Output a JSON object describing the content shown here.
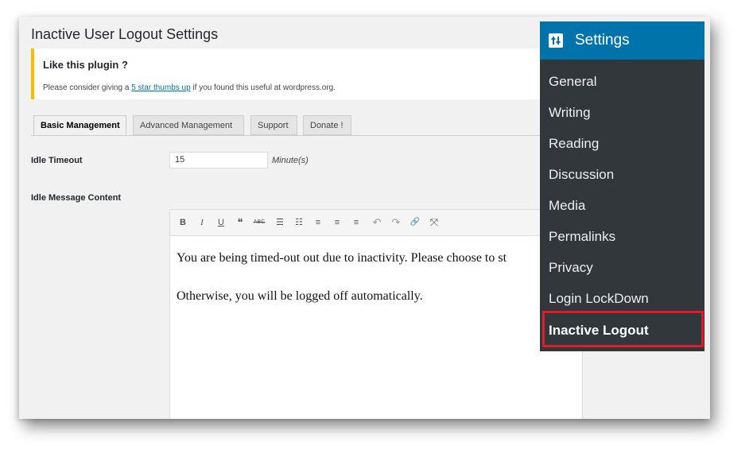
{
  "page": {
    "title": "Inactive User Logout Settings"
  },
  "notice": {
    "title": "Like this plugin ?",
    "text_before": "Please consider giving a ",
    "link_text": "5 star thumbs up",
    "text_after": " if you found this useful at wordpress.org."
  },
  "tabs": [
    {
      "label": "Basic Management",
      "active": true
    },
    {
      "label": "Advanced Management",
      "active": false
    },
    {
      "label": "Support",
      "active": false
    },
    {
      "label": "Donate !",
      "active": false
    }
  ],
  "form": {
    "idle_timeout_label": "Idle Timeout",
    "idle_timeout_value": "15",
    "idle_timeout_unit": "Minute(s)",
    "idle_message_label": "Idle Message Content"
  },
  "editor": {
    "toolbar": {
      "bold": "B",
      "italic": "I",
      "underline": "U",
      "blockquote": "❝",
      "strikethrough": "ABC",
      "bullet_list": "☰",
      "numbered_list": "☷",
      "align_left": "≡",
      "align_center": "≡",
      "align_right": "≡",
      "undo": "↶",
      "redo": "↷",
      "link": "🔗",
      "fullscreen": "⤧"
    },
    "paragraphs": [
      "You are being timed-out out due to inactivity. Please choose to st",
      "Otherwise, you will be logged off automatically."
    ]
  },
  "sidebar": {
    "header": "Settings",
    "items": [
      "General",
      "Writing",
      "Reading",
      "Discussion",
      "Media",
      "Permalinks",
      "Privacy",
      "Login LockDown",
      "Inactive Logout"
    ],
    "active_item": "Inactive Logout",
    "colors": {
      "background": "#32373c",
      "header": "#0073aa",
      "highlight": "#e21b2b"
    }
  },
  "icons": {
    "settings": "settings-sliders-icon"
  }
}
